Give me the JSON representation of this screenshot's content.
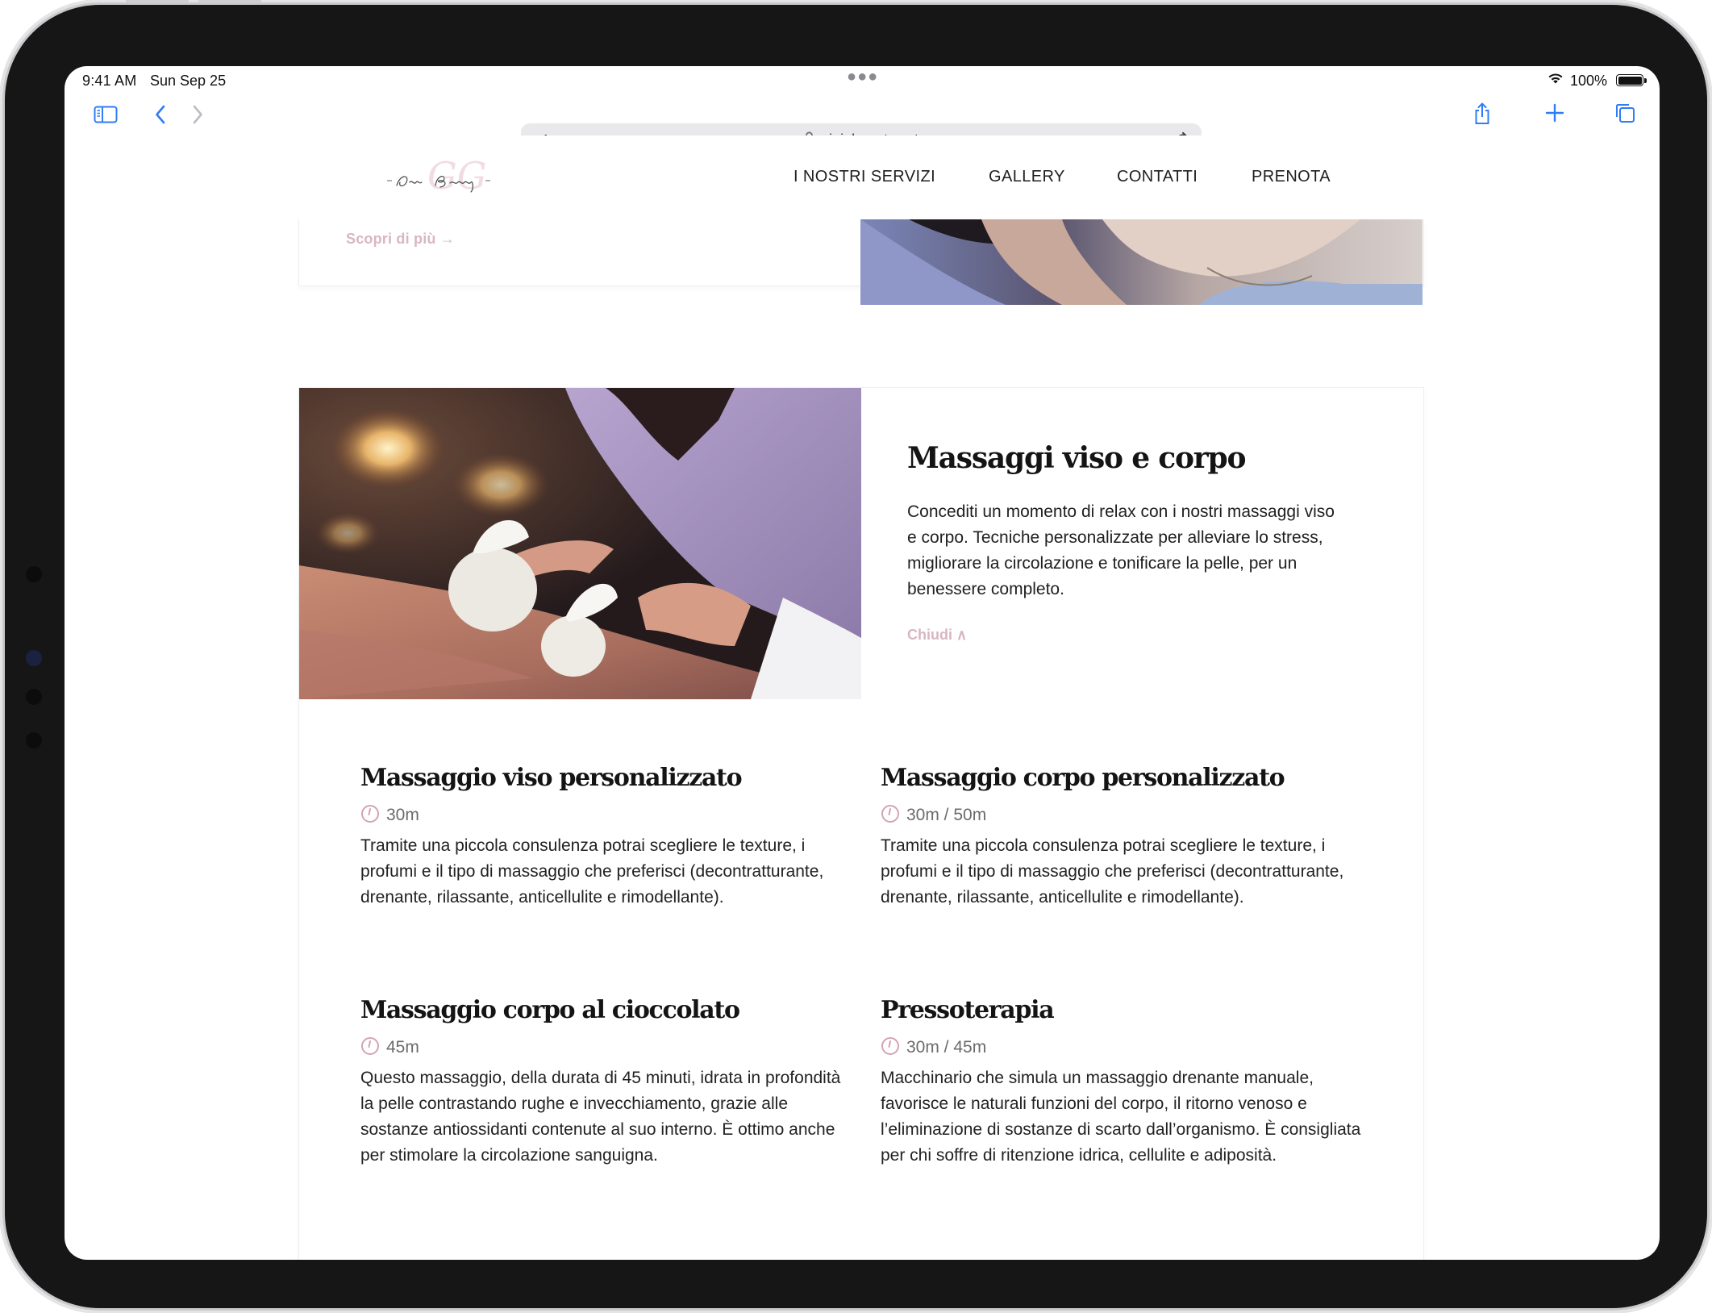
{
  "status_bar": {
    "time": "9:41 AM",
    "date": "Sun Sep 25",
    "battery": "100%"
  },
  "browser": {
    "reader_label_small": "A",
    "reader_label_big": "A",
    "url": "gioiabeauty.net"
  },
  "site": {
    "nav": [
      "I NOSTRI SERVIZI",
      "GALLERY",
      "CONTATTI",
      "PRENOTA"
    ],
    "previous_card_link": "Scopri di più →"
  },
  "section": {
    "title": "Massaggi viso e corpo",
    "description": "Concediti un momento di relax con i nostri massaggi viso e corpo. Tecniche personalizzate per alleviare lo stress, migliorare la circolazione e tonificare la pelle, per un benessere completo.",
    "close_label": "Chiudi ∧"
  },
  "services": [
    {
      "title": "Massaggio viso personalizzato",
      "duration": "30m",
      "description": "Tramite una piccola consulenza potrai scegliere le texture, i profumi e il tipo di massaggio che preferisci (decontratturante, drenante, rilassante, anticellulite e rimodellante)."
    },
    {
      "title": "Massaggio corpo personalizzato",
      "duration": "30m / 50m",
      "description": "Tramite una piccola consulenza potrai scegliere le texture, i profumi e il tipo di massaggio che preferisci (decontratturante, drenante, rilassante, anticellulite e rimodellante)."
    },
    {
      "title": "Massaggio corpo al cioccolato",
      "duration": "45m",
      "description": "Questo massaggio, della durata di 45 minuti, idrata in profondità la pelle contrastando rughe e invecchiamento, grazie alle sostanze antiossidanti contenute al suo interno. È ottimo anche per stimolare la circolazione sanguigna."
    },
    {
      "title": "Pressoterapia",
      "duration": "30m / 45m",
      "description": "Macchinario che simula un massaggio drenante manuale, favorisce le naturali funzioni del corpo, il ritorno venoso e l’eliminazione di sostanze di scarto dall’organismo. È consigliata per chi soffre di ritenzione idrica, cellulite e adiposità."
    }
  ],
  "colors": {
    "accent_link": "#d8b6c3",
    "browser_blue": "#2f7cf6",
    "text_dark": "#141414"
  }
}
